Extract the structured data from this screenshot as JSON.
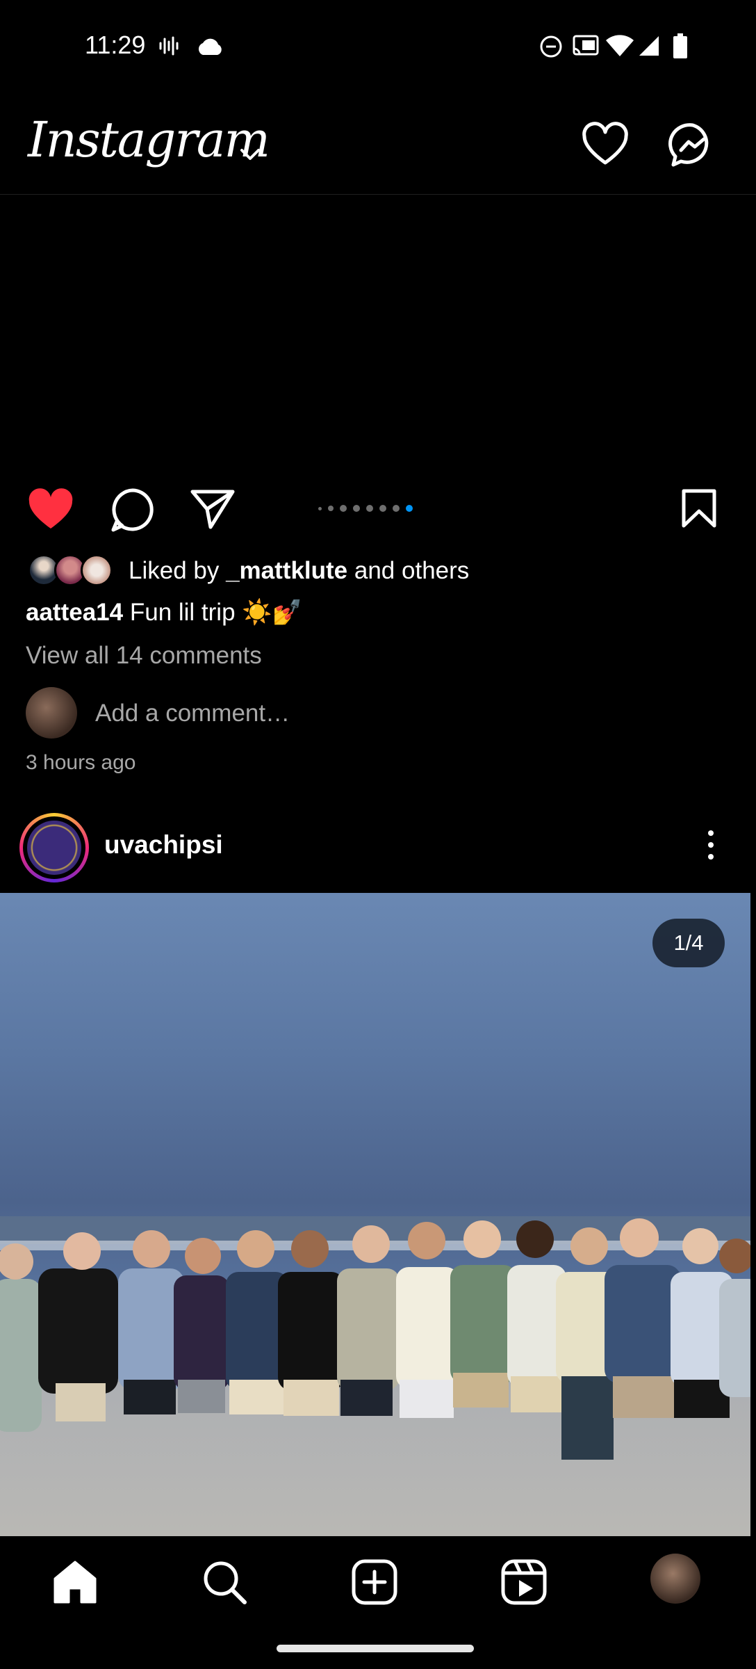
{
  "status_bar": {
    "time": "11:29",
    "icons": [
      "voicemail-icon",
      "cloud-icon",
      "do-not-disturb-icon",
      "cast-icon",
      "wifi-icon",
      "signal-icon",
      "battery-icon"
    ]
  },
  "header": {
    "logo": "Instagram",
    "icons": [
      "chevron-down-icon",
      "heart-icon",
      "messenger-icon"
    ]
  },
  "post": {
    "carousel": {
      "total_dots": 8,
      "active_index": 7,
      "active_color": "#0095f6"
    },
    "liked": true,
    "like_color": "#ff3040",
    "likes": {
      "prefix": "Liked by ",
      "user": "_mattklute",
      "suffix": " and others"
    },
    "caption": {
      "user": "aattea14",
      "text": "Fun lil trip ☀️💅"
    },
    "view_comments": "View all 14 comments",
    "comment_placeholder": "Add a comment…",
    "time_ago": "3 hours ago"
  },
  "next_post": {
    "username": "uvachipsi",
    "photo_counter": "1/4"
  },
  "bottom_nav": {
    "items": [
      "home-icon",
      "search-icon",
      "create-icon",
      "reels-icon",
      "profile-avatar"
    ]
  }
}
